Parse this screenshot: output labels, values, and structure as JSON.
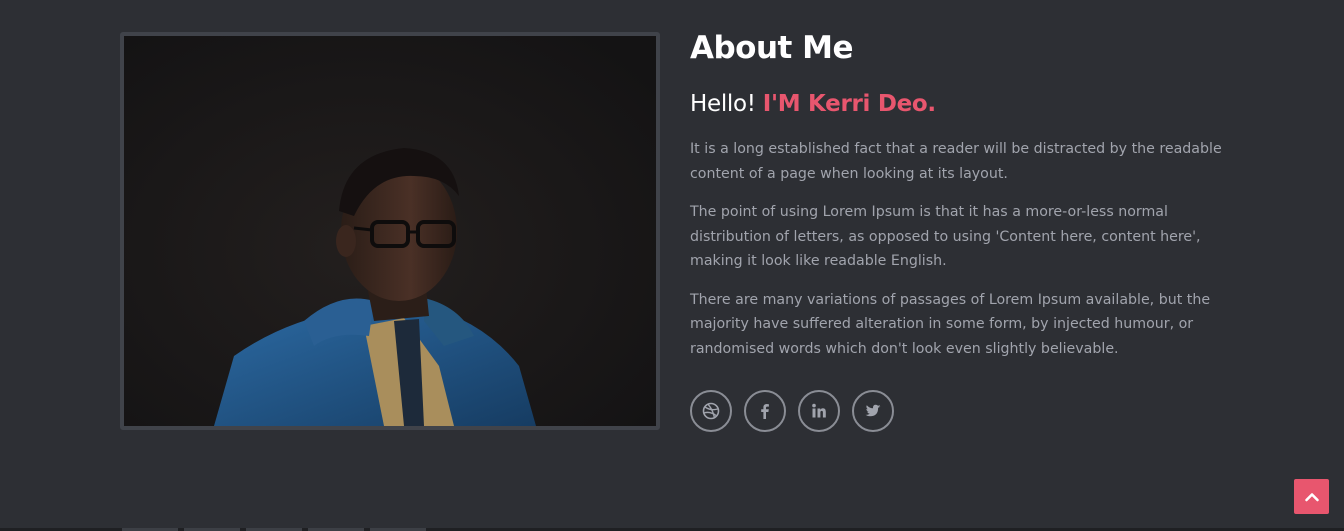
{
  "about": {
    "title": "About Me",
    "greeting_prefix": "Hello!",
    "name": "I'M Kerri Deo.",
    "paragraphs": [
      "It is a long established fact that a reader will be distracted by the readable content of a page when looking at its layout.",
      "The point of using Lorem Ipsum is that it has a more-or-less normal distribution of letters, as opposed to using 'Content here, content here', making it look like readable English.",
      "There are many variations of passages of Lorem Ipsum available, but the majority have suffered alteration in some form, by injected humour, or randomised words which don't look even slightly believable."
    ]
  },
  "socials": [
    {
      "icon": "dribbble-icon"
    },
    {
      "icon": "facebook-icon"
    },
    {
      "icon": "linkedin-icon"
    },
    {
      "icon": "twitter-icon"
    }
  ],
  "back_to_top": {
    "icon": "chevron-up-icon"
  },
  "colors": {
    "background": "#2d2f34",
    "accent": "#e8566e",
    "text_muted": "#a1a4ad",
    "heading": "#ffffff"
  }
}
